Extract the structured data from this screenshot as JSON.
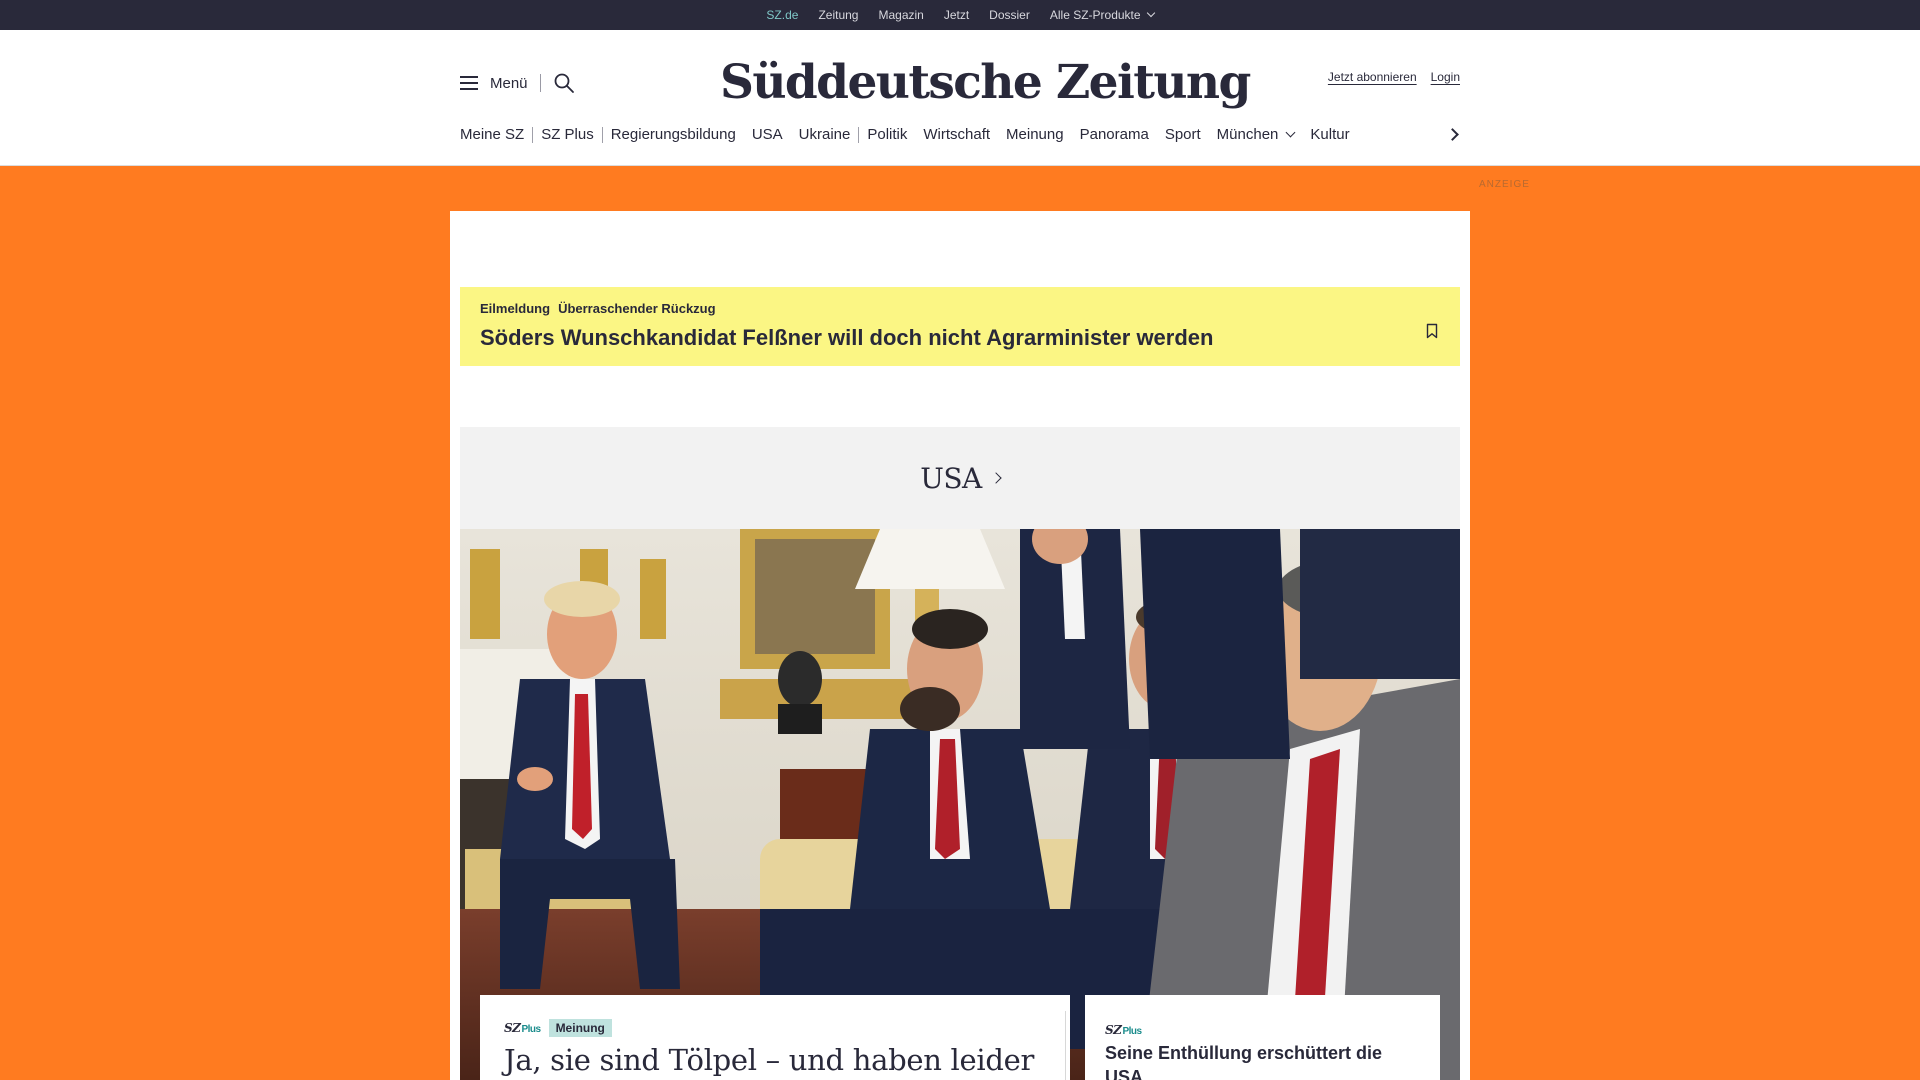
{
  "colors": {
    "page_bg": "#ff7b20",
    "topbar_bg": "#29293a",
    "breaking_bg": "#fbf684",
    "accent_teal": "#7fc8c8"
  },
  "topbar": {
    "items": [
      "SZ.de",
      "Zeitung",
      "Magazin",
      "Jetzt",
      "Dossier",
      "Alle SZ-Produkte"
    ],
    "active": "SZ.de"
  },
  "header": {
    "menu_label": "Menü",
    "logo": "Süddeutsche Zeitung",
    "subscribe_label": "Jetzt abonnieren",
    "login_label": "Login"
  },
  "nav": {
    "items": [
      "Meine SZ",
      "SZ Plus",
      "Regierungsbildung",
      "USA",
      "Ukraine",
      "Politik",
      "Wirtschaft",
      "Meinung",
      "Panorama",
      "Sport",
      "München",
      "Kultur"
    ]
  },
  "ad_label": "ANZEIGE",
  "breaking": {
    "kicker": "Eilmeldung",
    "topic": "Überraschender Rückzug",
    "headline": "Söders Wunschkandidat Felßner will doch nicht Agrarminister werden"
  },
  "section": {
    "title": "USA"
  },
  "teaser_main": {
    "brand": "SZ",
    "brand_suffix": "Plus",
    "tag": "Meinung",
    "headline": "Ja, sie sind Tölpel – und haben leider"
  },
  "teaser_side": {
    "brand": "SZ",
    "brand_suffix": "Plus",
    "headline": "Seine Enthüllung erschüttert die USA"
  },
  "icons": [
    "menu-icon",
    "search-icon",
    "chevron-down-icon",
    "chevron-right-icon",
    "bookmark-icon"
  ]
}
